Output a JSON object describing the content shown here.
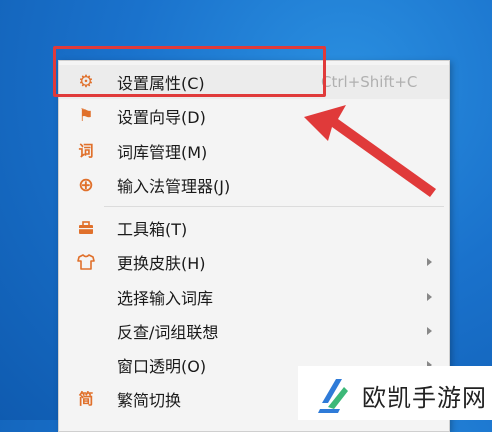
{
  "menu": {
    "items": [
      {
        "label": "设置属性(C)",
        "shortcut": "Ctrl+Shift+C",
        "icon": "gear-icon",
        "glyph": "⚙",
        "submenu": false
      },
      {
        "label": "设置向导(D)",
        "shortcut": "",
        "icon": "flag-icon",
        "glyph": "⚑",
        "submenu": false
      },
      {
        "label": "词库管理(M)",
        "shortcut": "",
        "icon": "word-icon",
        "glyph": "词",
        "submenu": false
      },
      {
        "label": "输入法管理器(J)",
        "shortcut": "",
        "icon": "grid-circle-icon",
        "glyph": "⊕",
        "submenu": false
      },
      {
        "label": "工具箱(T)",
        "shortcut": "",
        "icon": "toolbox-icon",
        "glyph": "▬",
        "submenu": false
      },
      {
        "label": "更换皮肤(H)",
        "shortcut": "",
        "icon": "shirt-icon",
        "glyph": "👕",
        "submenu": true
      },
      {
        "label": "选择输入词库",
        "shortcut": "",
        "icon": "",
        "glyph": "",
        "submenu": true
      },
      {
        "label": "反查/词组联想",
        "shortcut": "",
        "icon": "",
        "glyph": "",
        "submenu": true
      },
      {
        "label": "窗口透明(O)",
        "shortcut": "",
        "icon": "",
        "glyph": "",
        "submenu": true
      },
      {
        "label": "繁简切换",
        "shortcut": "",
        "icon": "traditional-simplified-icon",
        "glyph": "简",
        "submenu": false
      }
    ]
  },
  "watermark": {
    "text": "欧凯手游网"
  },
  "colors": {
    "highlight_box": "#e03a3a",
    "arrow": "#e03a3a",
    "icon_accent": "#e0702b",
    "logo_blue": "#2f7bd8",
    "logo_green": "#3cb878"
  }
}
